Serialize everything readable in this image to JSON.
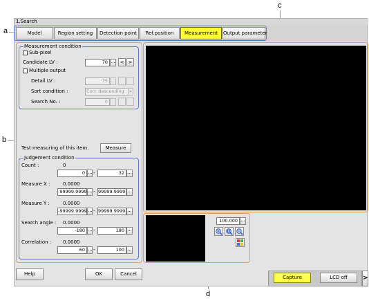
{
  "callouts": {
    "a": "a",
    "b": "b",
    "c": "c",
    "d": "d"
  },
  "window": {
    "title": "1.Search"
  },
  "tabs": [
    {
      "label": "Model",
      "active": false
    },
    {
      "label": "Region setting",
      "active": false
    },
    {
      "label": "Detection point",
      "active": false
    },
    {
      "label": "Ref.position",
      "active": false
    },
    {
      "label": "Measurement",
      "active": true
    },
    {
      "label": "Output parameter",
      "active": false
    }
  ],
  "measurement_condition": {
    "title": "Measurement condition",
    "subpixel_label": "Sub-pixel",
    "candidate_lv_label": "Candidate LV :",
    "candidate_lv_value": "70",
    "prev_symbol": "<",
    "next_symbol": ">",
    "multiple_output_label": "Multiple output",
    "detail_lv_label": "Detail LV :",
    "detail_lv_value": "75",
    "sort_condition_label": "Sort condition :",
    "sort_condition_value": "Corr. descending",
    "search_no_label": "Search No. :",
    "search_no_value": "0"
  },
  "test": {
    "label": "Test measuring of this item.",
    "button": "Measure"
  },
  "judgement_condition": {
    "title": "Judgement condition",
    "count": {
      "label": "Count :",
      "value": "0",
      "min": "0",
      "max": "32"
    },
    "measure_x": {
      "label": "Measure X :",
      "value": "0.0000",
      "min": "-99999.9999",
      "max": "99999.9999"
    },
    "measure_y": {
      "label": "Measure Y :",
      "value": "0.0000",
      "min": "-99999.9999",
      "max": "99999.9999"
    },
    "search_angle": {
      "label": "Search angle :",
      "value": "0.0000",
      "min": "-180",
      "max": "180"
    },
    "correlation": {
      "label": "Correlation :",
      "value": "0.0000",
      "min": "60",
      "max": "100"
    }
  },
  "range_sep": "-",
  "ellipsis": "...",
  "zoom": {
    "value": "100.000"
  },
  "bottom": {
    "help": "Help",
    "ok": "OK",
    "cancel": "Cancel",
    "capture": "Capture",
    "lcd_off": "LCD off",
    "arrow": ">"
  }
}
